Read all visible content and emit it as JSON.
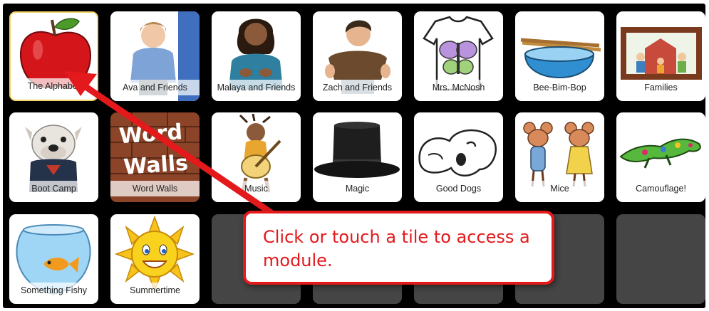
{
  "tiles": [
    {
      "label": "The Alphabet",
      "icon": "apple-icon"
    },
    {
      "label": "Ava and Friends",
      "icon": "girl-photo-icon"
    },
    {
      "label": "Malaya and Friends",
      "icon": "girl-signing-icon"
    },
    {
      "label": "Zach and Friends",
      "icon": "boy-photo-icon"
    },
    {
      "label": "Mrs. McNosh",
      "icon": "butterfly-shirt-icon"
    },
    {
      "label": "Bee-Bim-Bop",
      "icon": "bowl-icon"
    },
    {
      "label": "Families",
      "icon": "family-picture-icon"
    },
    {
      "label": "Boot Camp",
      "icon": "bulldog-icon"
    },
    {
      "label": "Word Walls",
      "icon": "word-wall-icon"
    },
    {
      "label": "Music",
      "icon": "girl-guitar-icon"
    },
    {
      "label": "Magic",
      "icon": "top-hat-icon"
    },
    {
      "label": "Good Dogs",
      "icon": "dog-drawing-icon"
    },
    {
      "label": "Mice",
      "icon": "mice-icon"
    },
    {
      "label": "Camouflage!",
      "icon": "lizard-icon"
    },
    {
      "label": "Something Fishy",
      "icon": "fishbowl-icon"
    },
    {
      "label": "Summertime",
      "icon": "sun-icon"
    }
  ],
  "word_wall_text": [
    "Word",
    "Walls"
  ],
  "callout": {
    "text": "Click or touch a tile to access a module."
  },
  "colors": {
    "annotation": "#e3191c",
    "background": "#000000",
    "empty_tile": "#454545"
  }
}
